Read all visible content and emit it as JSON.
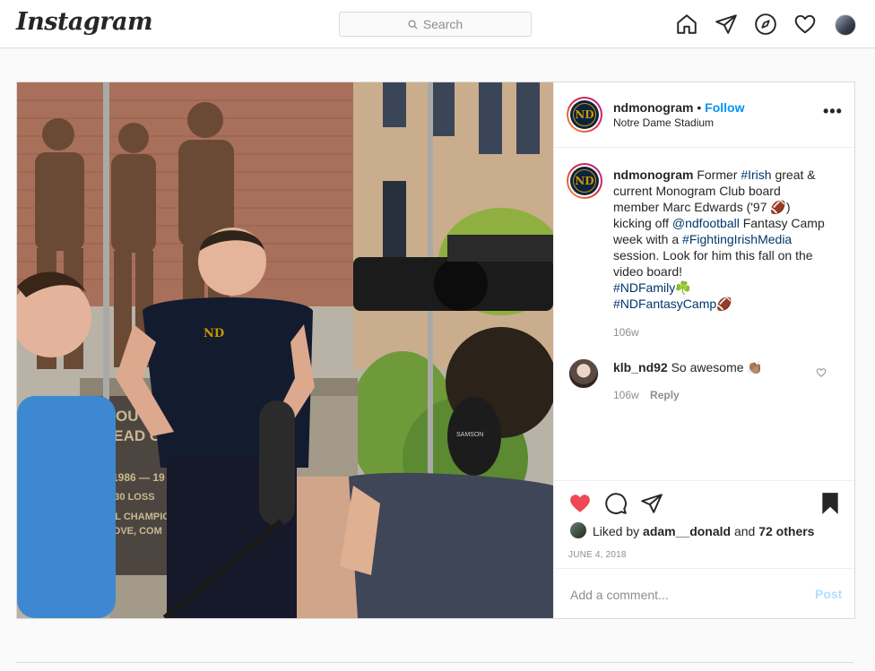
{
  "topbar": {
    "logo": "Instagram",
    "search_placeholder": "Search",
    "icons": [
      "home-icon",
      "direct-icon",
      "explore-icon",
      "activity-heart-icon",
      "profile-avatar"
    ]
  },
  "post": {
    "header": {
      "username": "ndmonogram",
      "separator": " • ",
      "follow": "Follow",
      "location": "Notre Dame Stadium",
      "more": "•••"
    },
    "caption": {
      "username": "ndmonogram",
      "parts": [
        {
          "text": " Former ",
          "type": "text"
        },
        {
          "text": "#Irish",
          "type": "tag"
        },
        {
          "text": " great & current Monogram Club board member Marc Edwards ('97 🏈) kicking off ",
          "type": "text"
        },
        {
          "text": "@ndfootball",
          "type": "tag"
        },
        {
          "text": " Fantasy Camp week with a ",
          "type": "text"
        },
        {
          "text": "#FightingIrishMedia",
          "type": "tag"
        },
        {
          "text": " session. Look for him this fall on the video board! ",
          "type": "text"
        },
        {
          "text": "#NDFamily",
          "type": "tag"
        },
        {
          "text": "☘️ ",
          "type": "text"
        },
        {
          "text": "#NDFantasyCamp",
          "type": "tag"
        },
        {
          "text": "🏈",
          "type": "text"
        }
      ],
      "time": "106w"
    },
    "comment": {
      "username": "klb_nd92",
      "text": " So awesome 👏🏽",
      "time": "106w",
      "reply": "Reply"
    },
    "likes": {
      "prefix": "Liked by ",
      "user": "adam__donald",
      "middle": " and ",
      "others": "72 others"
    },
    "date": "JUNE 4, 2018",
    "add_comment": {
      "placeholder": "Add a comment...",
      "post_label": "Post"
    },
    "photo_text": {
      "plaque_line1": "OU HO",
      "plaque_line2": "HEAD COA",
      "plaque_line3": "1986 — 19",
      "plaque_line4": "100 W S, 30 LOSS",
      "plaque_line5": "NATIONAL CHAMPIO",
      "plaque_line6": "TRUE, LOVE, COM",
      "headphone_brand": "SAMSON"
    }
  },
  "colors": {
    "accent": "#0095f6",
    "liked_heart": "#ed4956",
    "tag": "#00376b",
    "nd_navy": "#0c2340",
    "nd_gold": "#c99700"
  }
}
